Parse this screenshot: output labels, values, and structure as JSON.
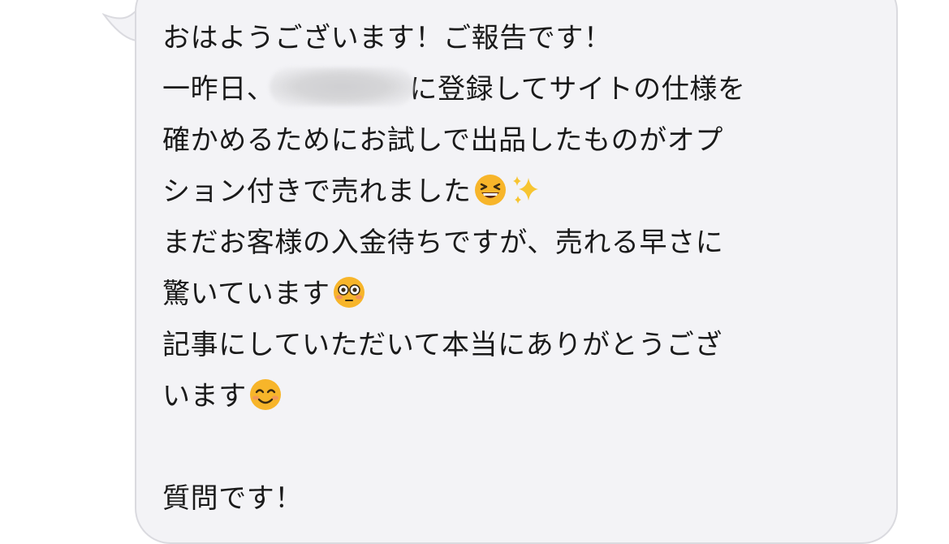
{
  "message": {
    "line1": "おはようございます！ご報告です！",
    "line2_before": "一昨日、",
    "line2_after": "に登録してサイトの仕様を",
    "line3": "確かめるためにお試しで出品したものがオプ",
    "line4": "ション付きで売れました",
    "line5": "まだお客様の入金待ちですが、売れる早さに",
    "line6": "驚いています",
    "line7": "記事にしていただいて本当にありがとうござ",
    "line8": "います",
    "line10": "質問です！"
  },
  "emojis": {
    "line4": [
      "grinning-squinting-face",
      "sparkles"
    ],
    "line6": [
      "flushed-face"
    ],
    "line8": [
      "smiling-face-with-smiling-eyes"
    ]
  },
  "colors": {
    "bubble_background": "#f3f3f6",
    "bubble_border": "#dadadf",
    "text": "#1a1a1a",
    "emoji_yellow": "#f7b52a"
  }
}
